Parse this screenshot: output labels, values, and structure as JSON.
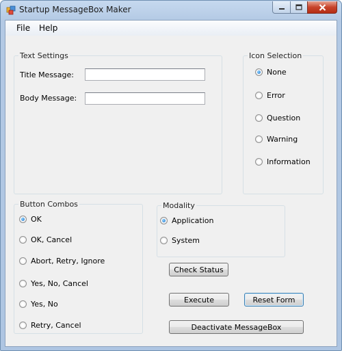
{
  "window": {
    "title": "Startup MessageBox Maker",
    "icon": "app-form-icon"
  },
  "menu": {
    "items": [
      "File",
      "Help"
    ]
  },
  "text_settings": {
    "label": "Text Settings",
    "title_label": "Title Message:",
    "title_value": "",
    "body_label": "Body Message:",
    "body_value": ""
  },
  "icon_selection": {
    "label": "Icon Selection",
    "options": [
      "None",
      "Error",
      "Question",
      "Warning",
      "Information"
    ],
    "selected": "None"
  },
  "button_combos": {
    "label": "Button Combos",
    "options": [
      "OK",
      "OK, Cancel",
      "Abort, Retry, Ignore",
      "Yes, No, Cancel",
      "Yes, No",
      "Retry, Cancel"
    ],
    "selected": "OK"
  },
  "modality": {
    "label": "Modality",
    "options": [
      "Application",
      "System"
    ],
    "selected": "Application"
  },
  "buttons": {
    "check_status": "Check Status",
    "execute": "Execute",
    "reset_form": "Reset Form",
    "deactivate": "Deactivate MessageBox"
  },
  "colors": {
    "accent": "#1a6ecb",
    "close": "#c7432b",
    "frame": "#b3c9e4"
  }
}
